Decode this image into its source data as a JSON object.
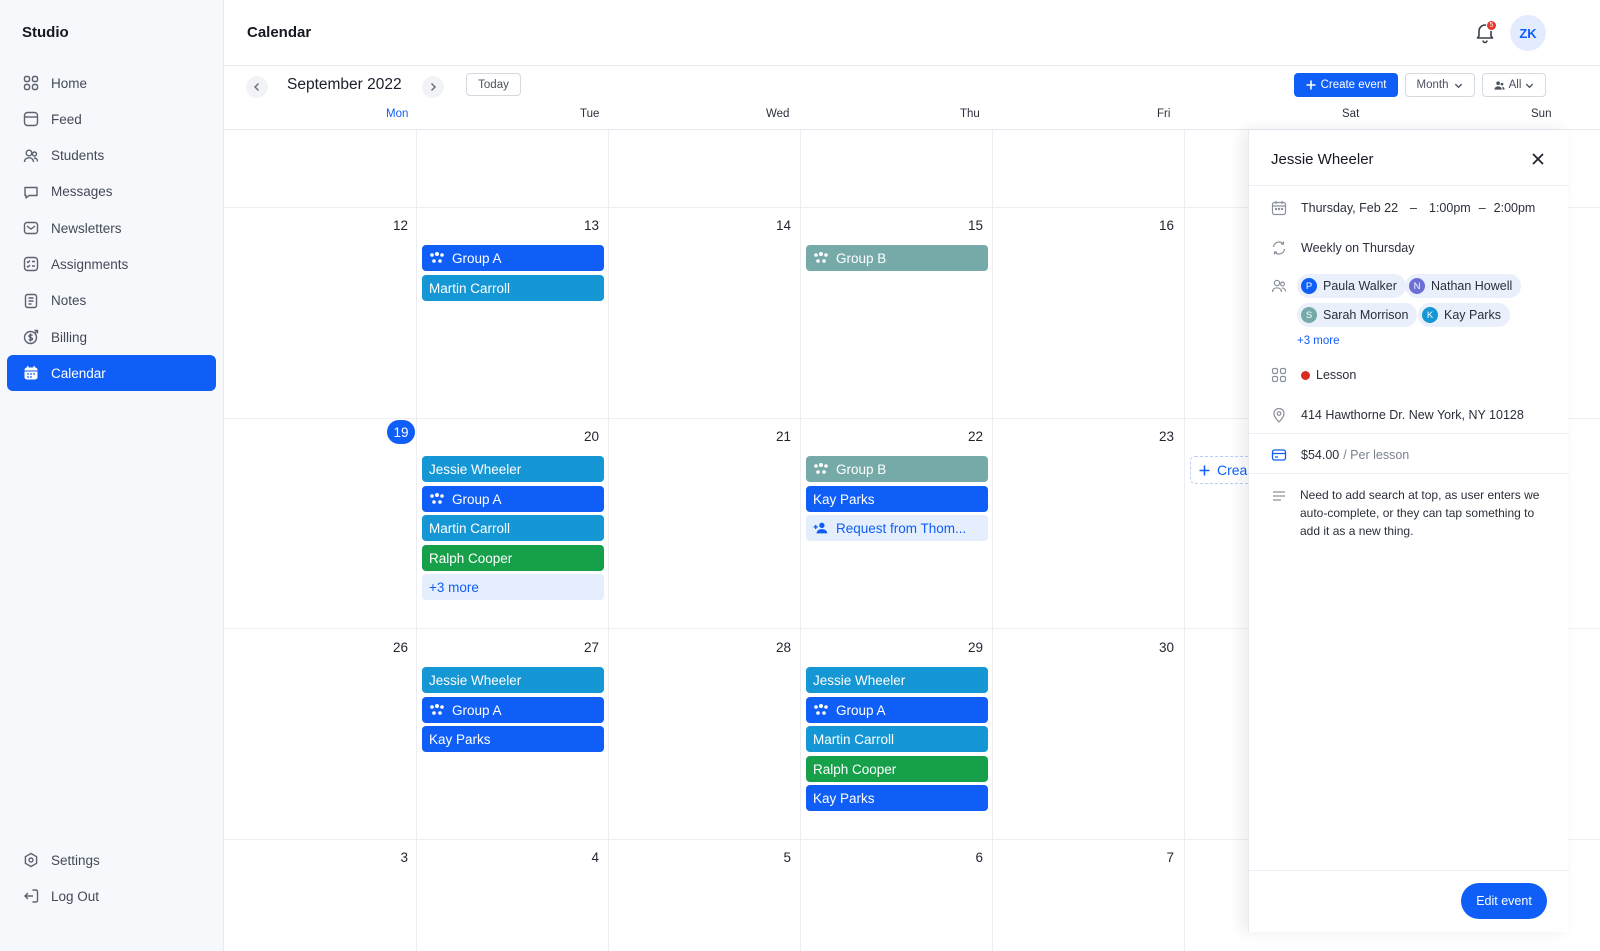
{
  "app": {
    "brand": "Studio",
    "page_title": "Calendar",
    "avatar_initials": "ZK",
    "notification_count": "5"
  },
  "sidebar": {
    "items": [
      {
        "label": "Home",
        "icon": "home-grid-icon"
      },
      {
        "label": "Feed",
        "icon": "feed-icon"
      },
      {
        "label": "Students",
        "icon": "students-icon"
      },
      {
        "label": "Messages",
        "icon": "message-icon"
      },
      {
        "label": "Newsletters",
        "icon": "newsletter-icon"
      },
      {
        "label": "Assignments",
        "icon": "assignment-icon"
      },
      {
        "label": "Notes",
        "icon": "notes-icon"
      },
      {
        "label": "Billing",
        "icon": "billing-icon"
      },
      {
        "label": "Calendar",
        "icon": "calendar-icon",
        "active": true
      }
    ],
    "bottom": [
      {
        "label": "Settings",
        "icon": "settings-icon"
      },
      {
        "label": "Log Out",
        "icon": "logout-icon"
      }
    ]
  },
  "toolbar": {
    "month_label": "September 2022",
    "today_label": "Today",
    "create_label": "Create event",
    "view_label": "Month",
    "filter_label": "All"
  },
  "weekdays": [
    "Mon",
    "Tue",
    "Wed",
    "Thu",
    "Fri",
    "Sat",
    "Sun"
  ],
  "weeks": [
    {
      "days": [
        "",
        "",
        "",
        "",
        "",
        "",
        ""
      ]
    },
    {
      "days": [
        "12",
        "13",
        "14",
        "15",
        "16",
        "",
        ""
      ]
    },
    {
      "days": [
        "19",
        "20",
        "21",
        "22",
        "23",
        "",
        ""
      ]
    },
    {
      "days": [
        "26",
        "27",
        "28",
        "29",
        "30",
        "",
        ""
      ]
    },
    {
      "days": [
        "3",
        "4",
        "5",
        "6",
        "7",
        "",
        ""
      ]
    }
  ],
  "events": {
    "w2_tue": [
      {
        "label": "Group A",
        "color": "blue",
        "group": true
      },
      {
        "label": "Martin Carroll",
        "color": "teal"
      }
    ],
    "w2_thu": [
      {
        "label": "Group B",
        "color": "sage",
        "group": true
      }
    ],
    "w3_tue": [
      {
        "label": "Jessie Wheeler",
        "color": "teal"
      },
      {
        "label": "Group A",
        "color": "blue",
        "group": true
      },
      {
        "label": "Martin Carroll",
        "color": "teal"
      },
      {
        "label": "Ralph Cooper",
        "color": "green"
      },
      {
        "label": "+3 more",
        "color": "more"
      }
    ],
    "w3_thu": [
      {
        "label": "Group B",
        "color": "sage",
        "group": true
      },
      {
        "label": "Kay Parks",
        "color": "blue"
      },
      {
        "label": "Request from Thom...",
        "color": "request"
      }
    ],
    "w4_tue": [
      {
        "label": "Jessie Wheeler",
        "color": "teal"
      },
      {
        "label": "Group A",
        "color": "blue",
        "group": true
      },
      {
        "label": "Kay Parks",
        "color": "blue"
      }
    ],
    "w4_thu": [
      {
        "label": "Jessie Wheeler",
        "color": "teal"
      },
      {
        "label": "Group A",
        "color": "blue",
        "group": true
      },
      {
        "label": "Martin Carroll",
        "color": "teal"
      },
      {
        "label": "Ralph Cooper",
        "color": "green"
      },
      {
        "label": "Kay Parks",
        "color": "blue"
      }
    ]
  },
  "create_slot_label": "Crea",
  "panel": {
    "title": "Jessie Wheeler",
    "date": "Thursday, Feb 22",
    "start": "1:00pm",
    "end": "2:00pm",
    "dash": "–",
    "recurrence": "Weekly on Thursday",
    "attendees": [
      {
        "initial": "P",
        "name": "Paula Walker",
        "color": "#0f5ef7"
      },
      {
        "initial": "N",
        "name": "Nathan Howell",
        "color": "#6b6fd6"
      },
      {
        "initial": "S",
        "name": "Sarah Morrison",
        "color": "#75aaa9"
      },
      {
        "initial": "K",
        "name": "Kay Parks",
        "color": "#1497d4"
      }
    ],
    "more_attendees": "+3 more",
    "type": "Lesson",
    "address": "414 Hawthorne Dr. New York, NY 10128",
    "price": "$54.00",
    "price_unit": "/ Per lesson",
    "note": "Need to add search at top, as user enters we auto-complete, or they can tap something to add it as a new thing.",
    "edit_label": "Edit event"
  },
  "colors": {
    "accent": "#0f5ef7",
    "teal": "#1497d4",
    "sage": "#75aaa9",
    "green": "#16a04a",
    "lesson_dot": "#d92d20"
  }
}
